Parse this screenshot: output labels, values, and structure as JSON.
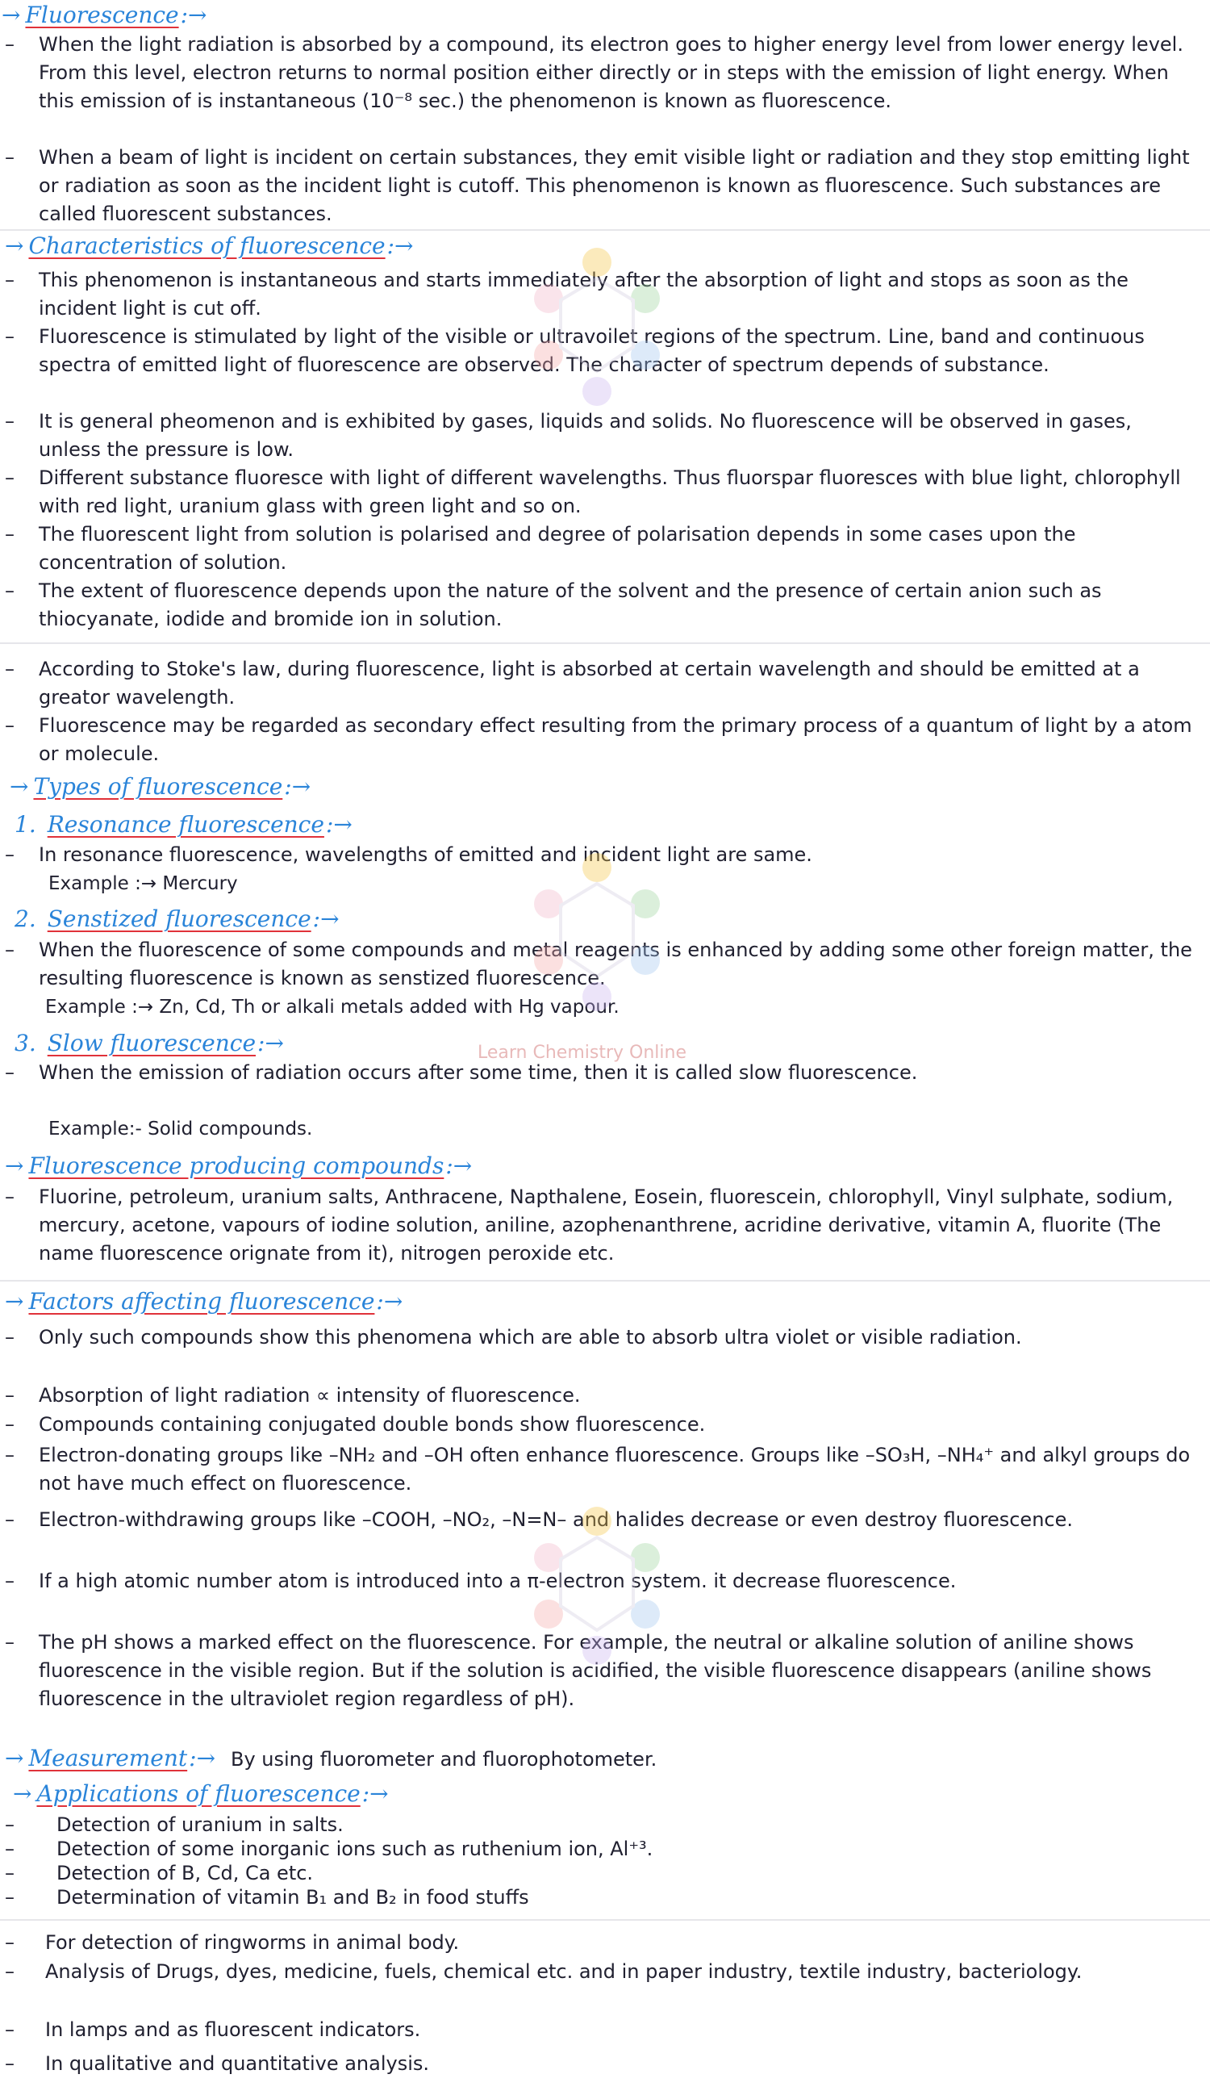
{
  "headings": {
    "fluorescence": "Fluorescence",
    "characteristics": "Characteristics of fluorescence",
    "types": "Types of fluorescence",
    "resonance": "Resonance fluorescence",
    "sensitized": "Senstized fluorescence",
    "slow": "Slow fluorescence",
    "compounds": "Fluorescence producing compounds",
    "factors": "Factors affecting fluorescence",
    "measurement": "Measurement",
    "applications": "Applications of fluorescence"
  },
  "arrow": "→",
  "tail": ":→",
  "dash": "–",
  "numbers": [
    "1.",
    "2.",
    "3."
  ],
  "intro": [
    "When the light radiation is absorbed by a compound, its electron goes to higher energy level from lower energy level. From this level, electron returns to normal position either directly or in steps with the emission of light energy. When this emission of is instantaneous (10⁻⁸ sec.) the phenomenon is known as fluorescence.",
    "When a beam of light is incident on certain substances, they emit visible light or radiation and they stop emitting light or radiation as soon as the incident light is cutoff. This phenomenon is known as fluorescence. Such substances are called fluorescent substances."
  ],
  "characteristics": [
    "This phenomenon is instantaneous and starts immediately after the absorption of light and stops as soon as the incident light is cut off.",
    "Fluorescence is stimulated by light of the visible or ultravoilet regions of the spectrum. Line, band and continuous spectra of emitted light of fluorescence are observed. The character of spectrum depends of substance.",
    "It is general pheomenon and is exhibited by gases, liquids and solids. No fluorescence will be observed in gases, unless the pressure is low.",
    "Different substance fluoresce with light of different wavelengths. Thus fluorspar fluoresces with blue light, chlorophyll with red light, uranium glass with green light and so on.",
    "The fluorescent light from solution is polarised and degree of polarisation depends in some cases upon the concentration of solution.",
    "The extent of fluorescence depends upon the nature of the solvent and the presence of certain anion such as thiocyanate, iodide and bromide ion in solution."
  ],
  "stokes": [
    "According to Stoke's law, during fluorescence, light is absorbed at certain wavelength and should be emitted at a greator wavelength.",
    "Fluorescence may be regarded as secondary effect resulting from the primary process of a quantum of light by a atom or molecule."
  ],
  "resonance": {
    "text": "In resonance fluorescence, wavelengths of emitted and incident light are same.",
    "example": "Example :→ Mercury"
  },
  "sensitized": {
    "text": "When the fluorescence of some compounds and metal reagents is enhanced by adding some other foreign matter, the resulting fluorescence is known as senstized fluorescence.",
    "example": "Example :→ Zn, Cd, Th or alkali metals added with Hg vapour."
  },
  "slow": {
    "text": "When the emission of radiation occurs after some time, then it is called slow fluorescence.",
    "example": "Example:- Solid compounds."
  },
  "compounds": "Fluorine, petroleum, uranium salts, Anthracene, Napthalene, Eosein, fluorescein, chlorophyll, Vinyl sulphate, sodium, mercury, acetone, vapours of iodine solution, aniline, azophenanthrene, acridine derivative, vitamin A, fluorite (The name fluorescence orignate from it), nitrogen peroxide etc.",
  "factors": [
    "Only such compounds show this phenomena which are able to absorb ultra violet or visible radiation.",
    "Absorption of light radiation ∝ intensity of fluorescence.",
    "Compounds containing conjugated double bonds show fluorescence.",
    "Electron-donating groups like –NH₂ and –OH often enhance fluorescence. Groups like –SO₃H, –NH₄⁺ and alkyl groups do not have much effect on fluorescence.",
    "Electron-withdrawing groups like –COOH, –NO₂, –N=N– and halides decrease or even destroy fluorescence.",
    "If a high atomic number atom is introduced into a π-electron system. it decrease fluorescence.",
    "The pH shows a marked effect on the fluorescence. For example, the neutral or alkaline solution of aniline shows fluorescence in the visible region. But if the solution is acidified, the visible fluorescence disappears (aniline shows fluorescence in the ultraviolet region regardless of pH)."
  ],
  "measurement": "By using fluorometer and fluorophotometer.",
  "applications": [
    "Detection of uranium in salts.",
    "Detection of some inorganic ions such as ruthenium ion, Al⁺³.",
    "Detection of B, Cd, Ca etc.",
    "Determination of vitamin B₁ and B₂ in food stuffs"
  ],
  "applications_more": [
    "For detection of ringworms in animal body.",
    "Analysis of Drugs, dyes, medicine, fuels, chemical etc. and in paper industry, textile industry, bacteriology.",
    "In lamps and as fluorescent indicators.",
    "In qualitative and quantitative analysis."
  ],
  "watermark": "Learn Chemistry Online",
  "colors": {
    "heading": "#2a84d9",
    "underline": "#e0323a",
    "text": "#202030"
  }
}
